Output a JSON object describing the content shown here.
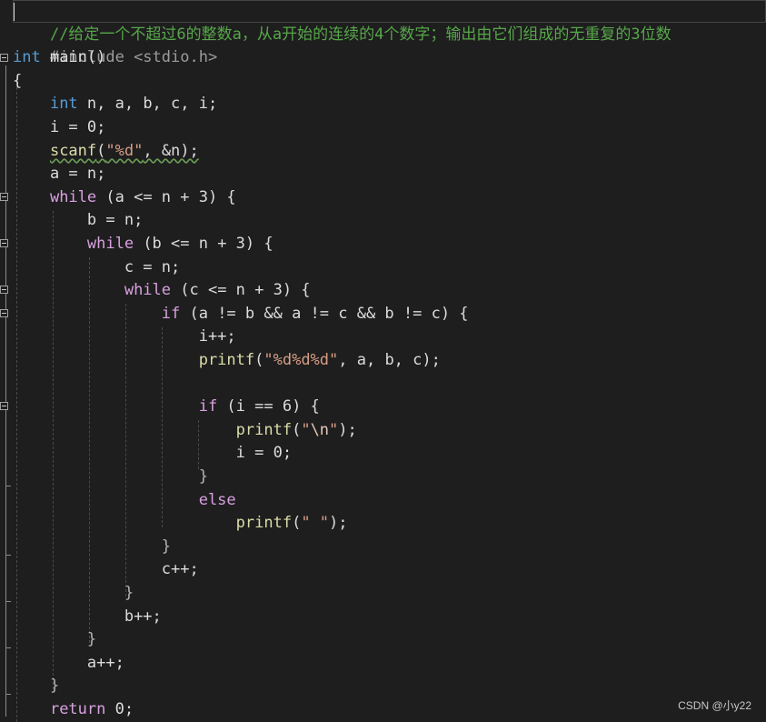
{
  "editor": {
    "language": "C",
    "comment": "//给定一个不超过6的整数a，从a开始的连续的4个数字；输出由它们组成的无重复的3位数",
    "include": "#include <stdio.h>",
    "tokens": {
      "int_kw": "int",
      "main_sig": " main()",
      "open_brace": "{",
      "close_brace": "}",
      "decl_vars": " n, a, b, c, i;",
      "i_init": "i = 0;",
      "scanf": "scanf",
      "scanf_args_open": "(",
      "scanf_fmt": "\"%d\"",
      "scanf_args_rest": ", &n);",
      "a_assign": "a = n;",
      "while_kw": "while",
      "while_a_cond": " (a <= n + 3) {",
      "b_assign": "b = n;",
      "while_b_cond": " (b <= n + 3) {",
      "c_assign": "c = n;",
      "while_c_cond": " (c <= n + 3) {",
      "if_kw": "if",
      "if_cond": " (a != b && a != c && b != c) {",
      "i_inc": "i++;",
      "printf": "printf",
      "printf_open": "(",
      "printf_fmt_digits": "\"%d%d%d\"",
      "printf_digit_args": ", a, b, c);",
      "if_i_cond": " (i == 6) {",
      "printf_nl_q1": "\"",
      "printf_nl_esc": "\\n",
      "printf_nl_q2": "\"",
      "printf_close": ");",
      "i_reset": "i = 0;",
      "else_kw": "else",
      "printf_space_str": "\" \"",
      "c_inc": "c++;",
      "b_inc": "b++;",
      "a_inc": "a++;",
      "return_kw": "return",
      "return_val": " 0;"
    }
  },
  "watermark": "CSDN @小y22",
  "colors": {
    "background": "#1e1e1e",
    "keyword": "#569cd6",
    "control": "#d8a0df",
    "function": "#dcdcaa",
    "string": "#d69d85",
    "number": "#b5cea8",
    "comment": "#57a64a"
  }
}
